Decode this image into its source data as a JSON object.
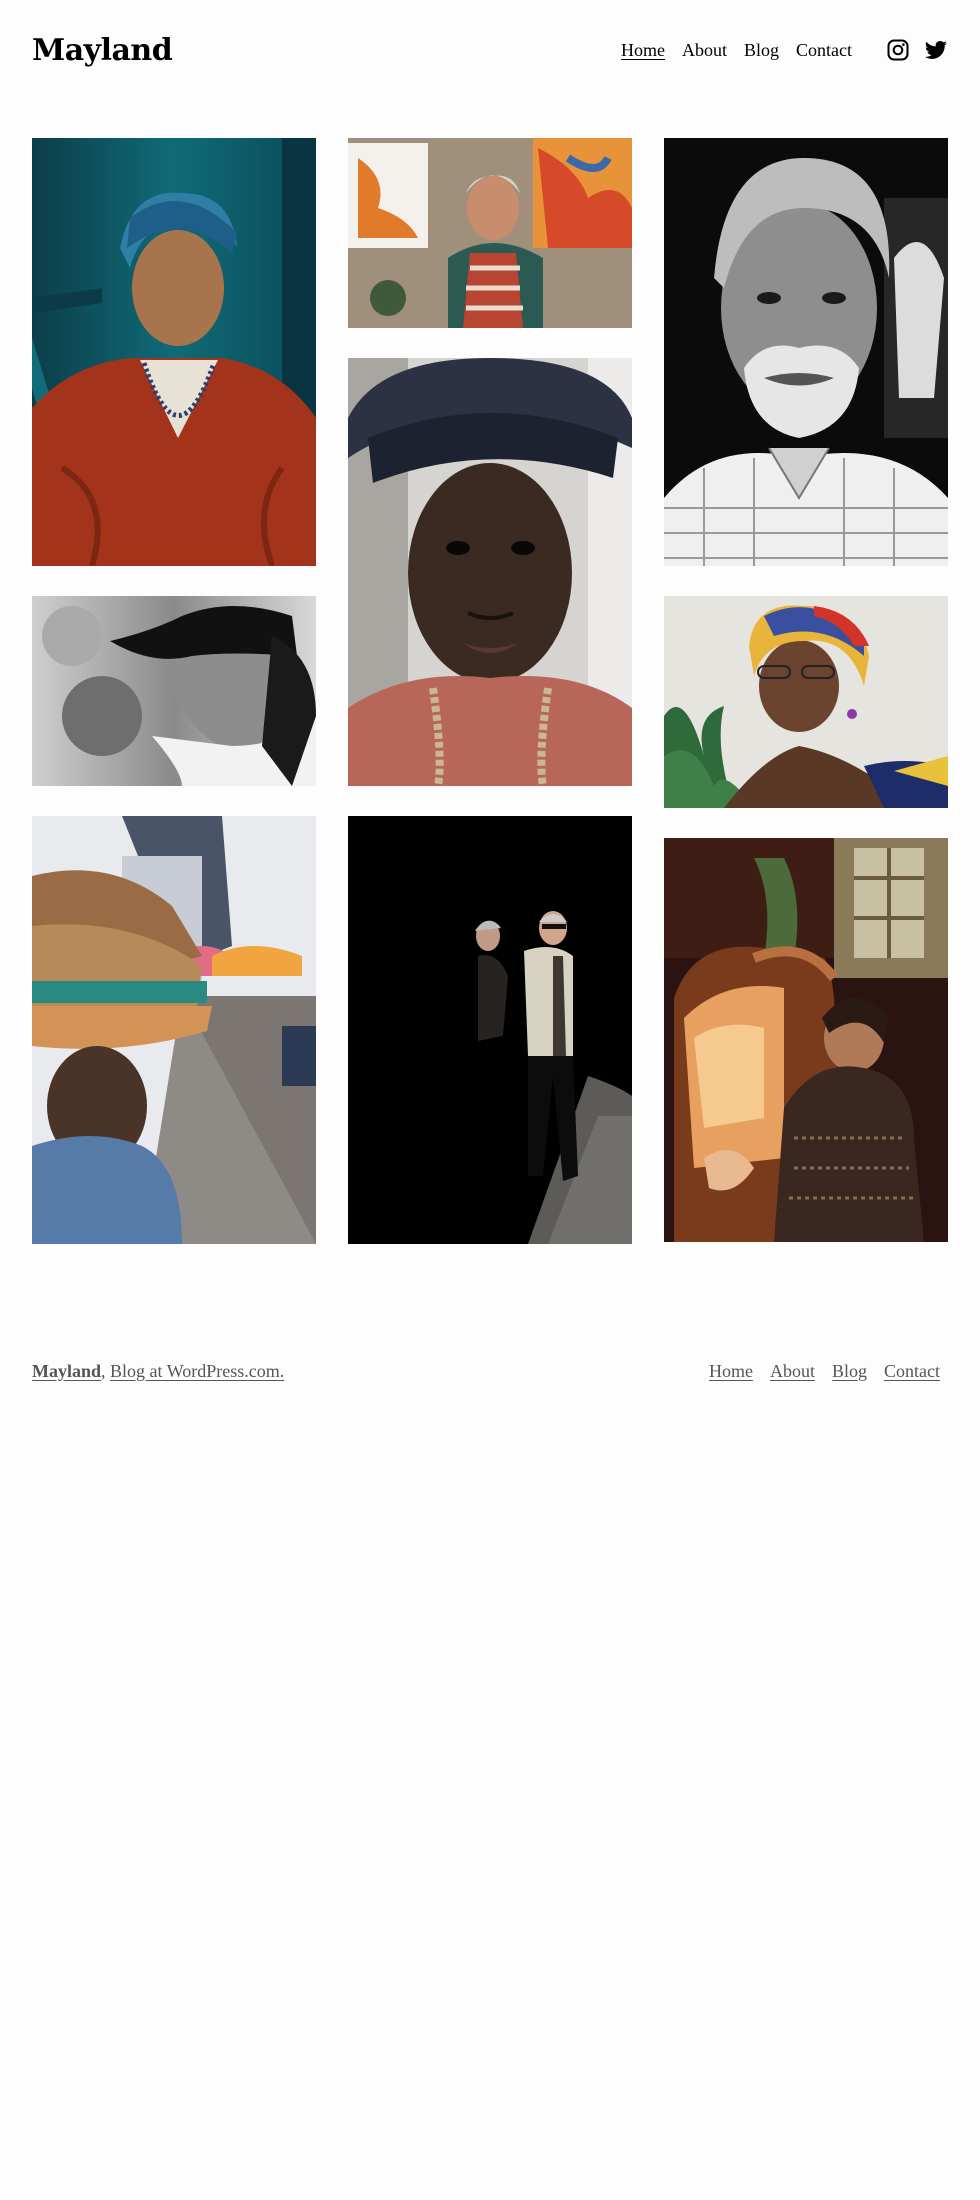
{
  "header": {
    "site_title": "Mayland",
    "nav": [
      "Home",
      "About",
      "Blog",
      "Contact"
    ],
    "current": "Home",
    "social_icons": [
      "instagram-icon",
      "twitter-icon"
    ]
  },
  "gallery": {
    "photos": [
      {
        "name": "woman-blue-headscarf-portrait"
      },
      {
        "name": "painter-with-apron"
      },
      {
        "name": "grey-bearded-man-bw-portrait"
      },
      {
        "name": "man-in-cap-bw-profile"
      },
      {
        "name": "young-man-in-cap-portrait"
      },
      {
        "name": "woman-colorful-headwrap"
      },
      {
        "name": "market-vendor-carrying-baskets"
      },
      {
        "name": "elderly-couple-walking"
      },
      {
        "name": "woman-in-armchair-sunlight"
      }
    ]
  },
  "footer": {
    "site_name": "Mayland",
    "separator": ",",
    "credit": "Blog at WordPress.com.",
    "nav": [
      "Home",
      "About",
      "Blog",
      "Contact"
    ]
  },
  "colors": {
    "background": "#fdfdfd",
    "text": "#000000",
    "footer_text": "#555555"
  }
}
